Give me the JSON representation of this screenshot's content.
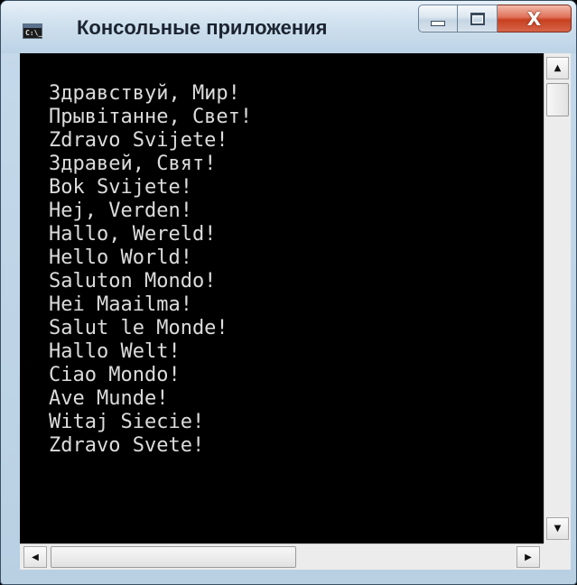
{
  "window": {
    "title": "Консольные приложения",
    "app_icon_text": "C:\\_",
    "icons": {
      "app": "console-app-icon",
      "minimize": "minimize-icon",
      "maximize": "maximize-icon",
      "close": "close-icon"
    },
    "close_glyph": "X"
  },
  "console": {
    "lines": [
      "Здравствуй, Мир!",
      "Прывітанне, Свет!",
      "Zdravo Svijete!",
      "Здравей, Свят!",
      "Bok Svijete!",
      "Hej, Verden!",
      "Hallo, Wereld!",
      "Hello World!",
      "Saluton Mondo!",
      "Hei Maailma!",
      "Salut le Monde!",
      "Hallo Welt!",
      "Ciao Mondo!",
      "Ave Munde!",
      "Witaj Siecie!",
      "Zdravo Svete!"
    ],
    "background_color": "#000000",
    "text_color": "#dcdcdc"
  },
  "scrollbars": {
    "up_arrow": "▲",
    "down_arrow": "▼",
    "left_arrow": "◀",
    "right_arrow": "▶"
  }
}
